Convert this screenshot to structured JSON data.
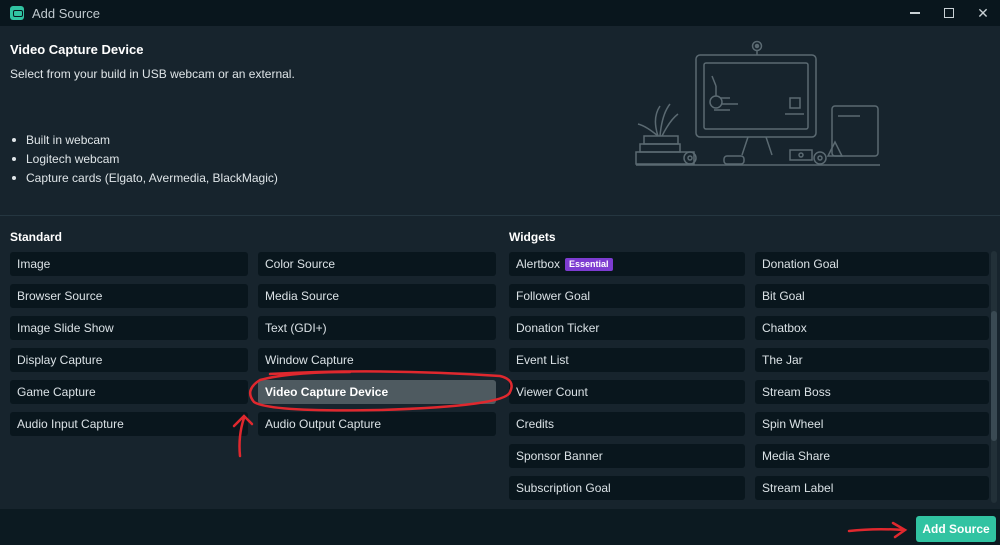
{
  "window": {
    "title": "Add Source",
    "icon": "streamlabs-logo-icon",
    "controls": [
      "minimize-icon",
      "maximize-icon",
      "close-icon"
    ],
    "close_glyph": "✕"
  },
  "header": {
    "title": "Video Capture Device",
    "description": "Select from your build in USB webcam or an external.",
    "features": [
      "Built in webcam",
      "Logitech webcam",
      "Capture cards (Elgato, Avermedia, BlackMagic)"
    ]
  },
  "standard": {
    "title": "Standard",
    "col1": [
      "Image",
      "Browser Source",
      "Image Slide Show",
      "Display Capture",
      "Game Capture",
      "Audio Input Capture"
    ],
    "col2": [
      "Color Source",
      "Media Source",
      "Text (GDI+)",
      "Window Capture",
      "Video Capture Device",
      "Audio Output Capture"
    ],
    "selected": "Video Capture Device"
  },
  "widgets": {
    "title": "Widgets",
    "col1": [
      "Alertbox",
      "Follower Goal",
      "Donation Ticker",
      "Event List",
      "Viewer Count",
      "Credits",
      "Sponsor Banner",
      "Subscription Goal"
    ],
    "col2": [
      "Donation Goal",
      "Bit Goal",
      "Chatbox",
      "The Jar",
      "Stream Boss",
      "Spin Wheel",
      "Media Share",
      "Stream Label"
    ],
    "badge": "Essential"
  },
  "footer": {
    "add_label": "Add Source"
  },
  "colors": {
    "accent": "#31c3a2",
    "badge": "#7d3cd1",
    "annotation": "#e0282e",
    "selected": "#4e5a60"
  }
}
